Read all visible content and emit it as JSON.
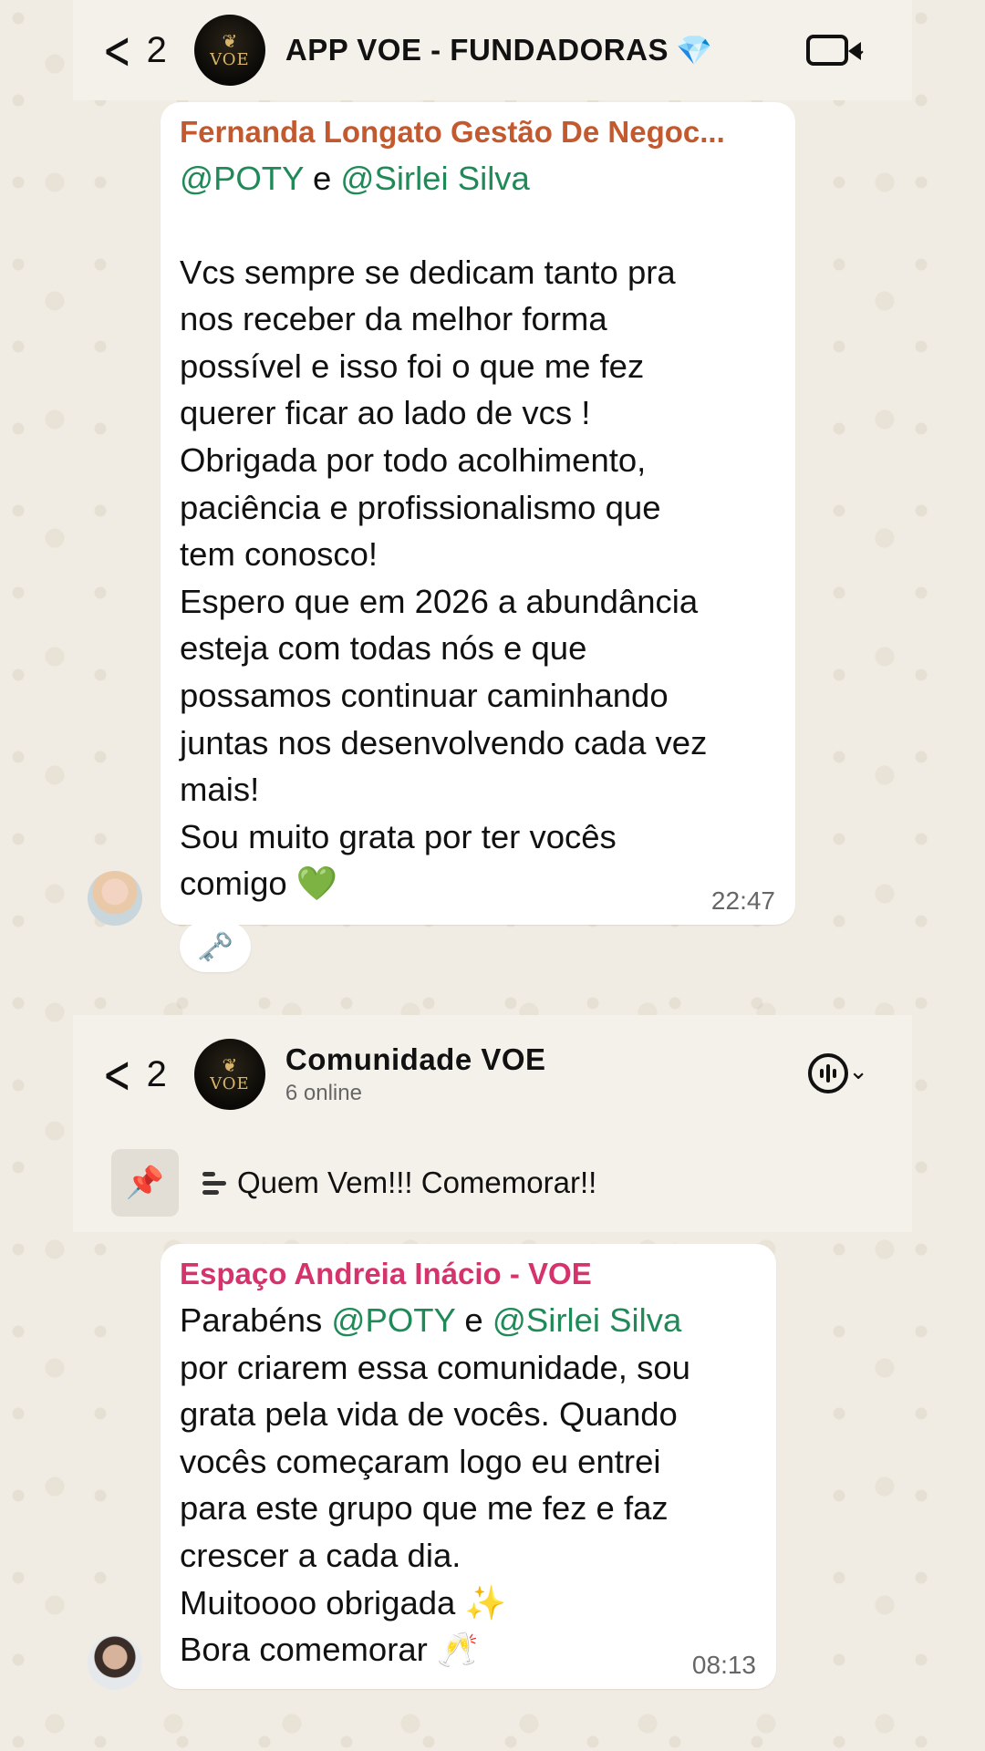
{
  "chat1": {
    "back_count": "2",
    "title": "APP VOE - FUNDADORAS",
    "title_emoji": "💎",
    "logo_text": "VOE",
    "message": {
      "sender": "Fernanda Longato Gestão De Negoc...",
      "mention1": "POTY",
      "connector": "e",
      "mention2": "Sirlei Silva",
      "body": "Vcs sempre se dedicam tanto pra\nnos receber da melhor forma\npossível e isso foi o que me fez\nquerer ficar ao lado de vcs !\nObrigada por todo acolhimento,\npaciência e profissionalismo que\ntem conosco!\nEspero que em 2026 a abundância\nesteja com todas nós e que\npossamos continuar caminhando\njuntas nos desenvolvendo cada vez\nmais!\nSou muito grata por ter vocês\ncomigo 💚",
      "time": "22:47",
      "reaction": "🗝️"
    }
  },
  "chat2": {
    "back_count": "2",
    "title": "Comunidade VOE",
    "status": "6 online",
    "logo_text": "VOE",
    "pinned": "Quem Vem!!! Comemorar!!",
    "message": {
      "sender": "Espaço Andreia Inácio - VOE",
      "prefix": "Parabéns",
      "mention1": "POTY",
      "connector": "e",
      "mention2": "Sirlei Silva",
      "body": "por criarem essa comunidade, sou\ngrata pela vida de vocês. Quando\nvocês começaram logo eu entrei\npara este grupo que me fez e faz\ncrescer a cada dia.\nMuitoooo obrigada ✨\nBora comemorar 🥂",
      "time": "08:13"
    }
  },
  "icons": [
    "chevron-left-icon",
    "video-call-icon",
    "chevron-down-icon",
    "voice-chat-icon",
    "pin-icon",
    "poll-lines-icon"
  ]
}
